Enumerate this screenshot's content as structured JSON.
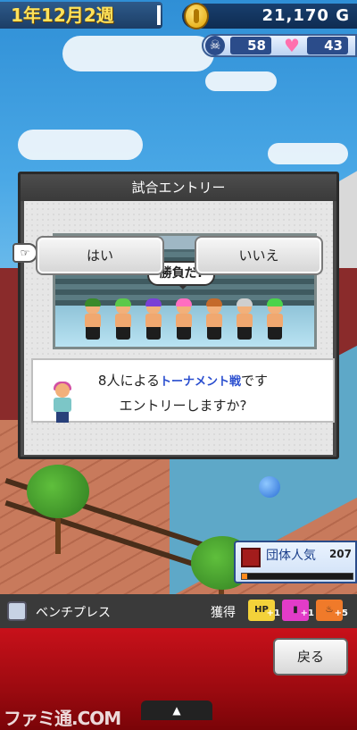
{
  "hud": {
    "date": "1年12月2週",
    "money": "21,170 G",
    "skull_count": "58",
    "heart_count": "43"
  },
  "dialog": {
    "title": "試合エントリー",
    "speech": "勝負だ!",
    "message_line1_pre": "8人による",
    "message_line1_highlight": "トーナメント戦",
    "message_line1_post": "です",
    "message_line2": "エントリーしますか?",
    "yes_label": "はい",
    "no_label": "いいえ",
    "fighter_hair_colors": [
      "#3a8a2a",
      "#5cc94a",
      "#7a3fd6",
      "#ff6ec0",
      "#c46a2a",
      "#cfcfcf",
      "#4bd34b"
    ]
  },
  "popularity": {
    "label": "団体人気",
    "value": "207",
    "level": 0.05
  },
  "bottom": {
    "task_label": "ベンチプレス",
    "gain_label": "獲得",
    "gains": [
      {
        "icon": "hp-icon",
        "text": "HP",
        "amount": "+1",
        "color": "#f3d23a"
      },
      {
        "icon": "book-icon",
        "text": "▮",
        "amount": "+1",
        "color": "#e23cc8"
      },
      {
        "icon": "heart-up-icon",
        "text": "♨",
        "amount": "+5",
        "color": "#f07a2a"
      }
    ],
    "back_label": "戻る",
    "tab_glyph": "▲",
    "watermark": "ファミ通.COM"
  }
}
